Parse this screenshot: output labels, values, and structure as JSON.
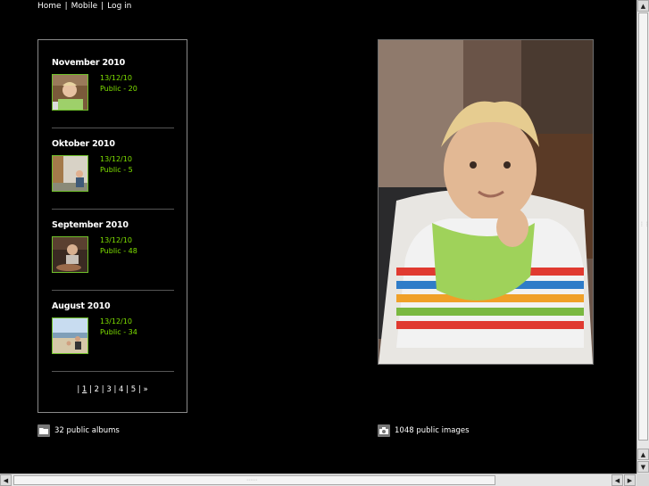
{
  "nav": {
    "home": "Home",
    "mobile": "Mobile",
    "login": "Log in",
    "sep": "|"
  },
  "albums": [
    {
      "title": "November 2010",
      "date": "13/12/10",
      "info": "Public - 20"
    },
    {
      "title": "Oktober 2010",
      "date": "13/12/10",
      "info": "Public - 5"
    },
    {
      "title": "September 2010",
      "date": "13/12/10",
      "info": "Public - 48"
    },
    {
      "title": "August 2010",
      "date": "13/12/10",
      "info": "Public - 34"
    }
  ],
  "pager": {
    "pages": [
      "1",
      "2",
      "3",
      "4",
      "5"
    ],
    "next": "»",
    "current": "1"
  },
  "stats": {
    "albums": "32 public albums",
    "images": "1048 public images"
  },
  "colors": {
    "background": "#000000",
    "accent": "#7fe000",
    "thumb_border": "#6fbf2a"
  },
  "icons": {
    "albums": "folder-icon",
    "images": "camera-icon"
  }
}
